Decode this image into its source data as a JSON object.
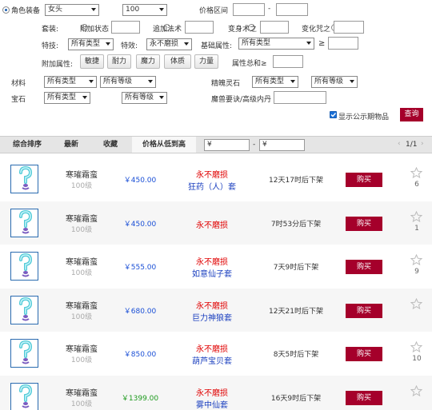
{
  "filters": {
    "row1": {
      "category_label": "角色装备",
      "gender_value": "女头",
      "level_value": "100",
      "price_range_label": "价格区间",
      "price_sep": "-"
    },
    "row2": {
      "set_label": "套装:",
      "opt_extra_state": "附加状态",
      "opt_extra_spell": "追加法术",
      "opt_transform": "变身术之",
      "opt_change_spell": "变化咒之"
    },
    "row3": {
      "skill_label": "特技:",
      "skill_value": "所有类型",
      "effect_label": "特效:",
      "effect_value": "永不磨损",
      "base_attr_label": "基础属性:",
      "base_attr_value": "所有类型",
      "gte": "≥"
    },
    "row4": {
      "extra_attr_label": "附加属性:",
      "attr_buttons": [
        "敏捷",
        "耐力",
        "魔力",
        "体质",
        "力量"
      ],
      "attr_total_label": "属性总和≥"
    },
    "row5": {
      "material_label": "材料",
      "material_type": "所有类型",
      "material_level": "所有等级",
      "spirit_label": "精魄灵石",
      "spirit_type": "所有类型",
      "spirit_level": "所有等级"
    },
    "row6": {
      "gem_label": "宝石",
      "gem_type": "所有类型",
      "gem_level": "所有等级",
      "beast_label": "魔兽要诀/高级内丹"
    },
    "show_public_label": "显示公示期物品",
    "query_label": "查询"
  },
  "sort_tabs": [
    "综合排序",
    "最新",
    "收藏",
    "价格从低到高"
  ],
  "price_filter": {
    "min_placeholder": "¥",
    "max_placeholder": "¥",
    "sep": "-"
  },
  "pager": {
    "prev": "‹",
    "page": "1/1",
    "next": "›"
  },
  "colors": {
    "price_blue": "#1a4fd6",
    "price_green": "#1d9a1d",
    "durability_red": "#e00000",
    "buy_red": "#a5002b",
    "set_blue": "#1a3fbf"
  },
  "items": [
    {
      "name": "寒璀霜蛮",
      "level": "100级",
      "price": "￥450.00",
      "price_color": "blue",
      "effect": "永不磨损",
      "set": "狂药（人）套",
      "time": "12天17时后下架",
      "buy": "购买",
      "fav_count": "6",
      "icon": "hook-equipment-icon"
    },
    {
      "name": "寒璀霜蛮",
      "level": "100级",
      "price": "￥450.00",
      "price_color": "blue",
      "effect": "永不磨损",
      "set": "",
      "time": "7时53分后下架",
      "buy": "购买",
      "fav_count": "1",
      "icon": "hook-equipment-icon"
    },
    {
      "name": "寒璀霜蛮",
      "level": "100级",
      "price": "￥555.00",
      "price_color": "blue",
      "effect": "永不磨损",
      "set": "如意仙子套",
      "time": "7天9时后下架",
      "buy": "购买",
      "fav_count": "9",
      "icon": "hook-equipment-icon"
    },
    {
      "name": "寒璀霜蛮",
      "level": "100级",
      "price": "￥680.00",
      "price_color": "blue",
      "effect": "永不磨损",
      "set": "巨力神狼套",
      "time": "12天21时后下架",
      "buy": "购买",
      "fav_count": "",
      "icon": "hook-equipment-icon"
    },
    {
      "name": "寒璀霜蛮",
      "level": "100级",
      "price": "￥850.00",
      "price_color": "blue",
      "effect": "永不磨损",
      "set": "葫芦宝贝套",
      "time": "8天5时后下架",
      "buy": "购买",
      "fav_count": "10",
      "icon": "hook-equipment-icon"
    },
    {
      "name": "寒璀霜蛮",
      "level": "100级",
      "price": "￥1399.00",
      "price_color": "green",
      "effect": "永不磨损",
      "set": "雾中仙套",
      "time": "16天9时后下架",
      "buy": "购买",
      "fav_count": "",
      "icon": "hook-equipment-icon"
    }
  ]
}
